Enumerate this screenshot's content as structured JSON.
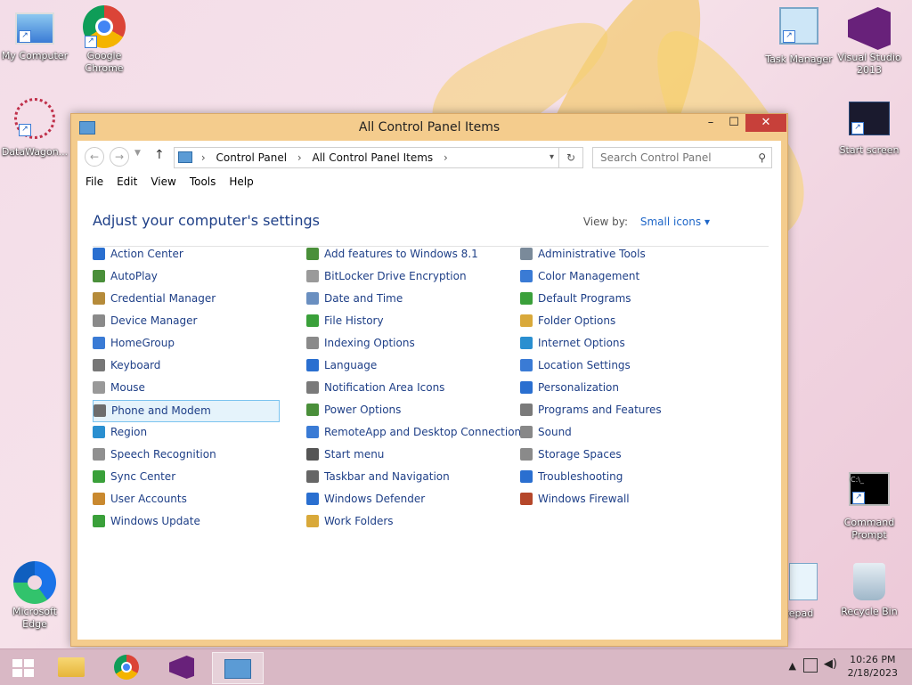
{
  "desktop": {
    "icons_left": [
      {
        "label": "My Computer",
        "icon": "computer-icon"
      },
      {
        "label": "Google\nChrome",
        "icon": "chrome-icon"
      },
      {
        "label": "DataWagon...",
        "icon": "datawagon-icon"
      },
      {
        "label": "Microsoft\nEdge",
        "icon": "edge-icon"
      }
    ],
    "icons_right": [
      {
        "label": "Task Manager",
        "icon": "task-manager-icon"
      },
      {
        "label": "Visual Studio\n2013",
        "icon": "visual-studio-icon"
      },
      {
        "label": "Start screen",
        "icon": "start-screen-icon"
      },
      {
        "label": "Command\nPrompt",
        "icon": "command-prompt-icon"
      },
      {
        "label": "otepad",
        "icon": "notepad-icon"
      },
      {
        "label": "Recycle Bin",
        "icon": "recycle-bin-icon"
      }
    ]
  },
  "window": {
    "title": "All Control Panel Items",
    "controls": {
      "minimize": "–",
      "maximize": "☐",
      "close": "✕"
    },
    "breadcrumb": [
      "Control Panel",
      "All Control Panel Items"
    ],
    "search_placeholder": "Search Control Panel",
    "menu": [
      "File",
      "Edit",
      "View",
      "Tools",
      "Help"
    ],
    "heading": "Adjust your computer's settings",
    "view_by_label": "View by:",
    "view_by_value": "Small icons",
    "columns": [
      [
        {
          "label": "Action Center",
          "color": "#2a6fd0"
        },
        {
          "label": "AutoPlay",
          "color": "#4a8f3a"
        },
        {
          "label": "Credential Manager",
          "color": "#b58b3a"
        },
        {
          "label": "Device Manager",
          "color": "#8a8a8a"
        },
        {
          "label": "HomeGroup",
          "color": "#3a7bd5"
        },
        {
          "label": "Keyboard",
          "color": "#777777"
        },
        {
          "label": "Mouse",
          "color": "#999999"
        },
        {
          "label": "Phone and Modem",
          "color": "#6d6d6d",
          "selected": true
        },
        {
          "label": "Region",
          "color": "#2a8fd0"
        },
        {
          "label": "Speech Recognition",
          "color": "#909090"
        },
        {
          "label": "Sync Center",
          "color": "#3aa03a"
        },
        {
          "label": "User Accounts",
          "color": "#c9892f"
        },
        {
          "label": "Windows Update",
          "color": "#3aa03a"
        }
      ],
      [
        {
          "label": "Add features to Windows 8.1",
          "color": "#4a8f3a"
        },
        {
          "label": "BitLocker Drive Encryption",
          "color": "#9a9a9a"
        },
        {
          "label": "Date and Time",
          "color": "#6a8fc0"
        },
        {
          "label": "File History",
          "color": "#3aa03a"
        },
        {
          "label": "Indexing Options",
          "color": "#8a8a8a"
        },
        {
          "label": "Language",
          "color": "#2a6fd0"
        },
        {
          "label": "Notification Area Icons",
          "color": "#7a7a7a"
        },
        {
          "label": "Power Options",
          "color": "#4a8f3a"
        },
        {
          "label": "RemoteApp and Desktop Connections",
          "color": "#3a7bd5"
        },
        {
          "label": "Start menu",
          "color": "#555555"
        },
        {
          "label": "Taskbar and Navigation",
          "color": "#666666"
        },
        {
          "label": "Windows Defender",
          "color": "#2a6fd0"
        },
        {
          "label": "Work Folders",
          "color": "#d9a93a"
        }
      ],
      [
        {
          "label": "Administrative Tools",
          "color": "#7a8a9a"
        },
        {
          "label": "Color Management",
          "color": "#3a7bd5"
        },
        {
          "label": "Default Programs",
          "color": "#3aa03a"
        },
        {
          "label": "Folder Options",
          "color": "#d9a93a"
        },
        {
          "label": "Internet Options",
          "color": "#2a8fd0"
        },
        {
          "label": "Location Settings",
          "color": "#3a7bd5"
        },
        {
          "label": "Personalization",
          "color": "#2a6fd0"
        },
        {
          "label": "Programs and Features",
          "color": "#7a7a7a"
        },
        {
          "label": "Sound",
          "color": "#888888"
        },
        {
          "label": "Storage Spaces",
          "color": "#8a8a8a"
        },
        {
          "label": "Troubleshooting",
          "color": "#2a6fd0"
        },
        {
          "label": "Windows Firewall",
          "color": "#b5472a"
        }
      ]
    ]
  },
  "taskbar": {
    "time": "10:26 PM",
    "date": "2/18/2023"
  }
}
